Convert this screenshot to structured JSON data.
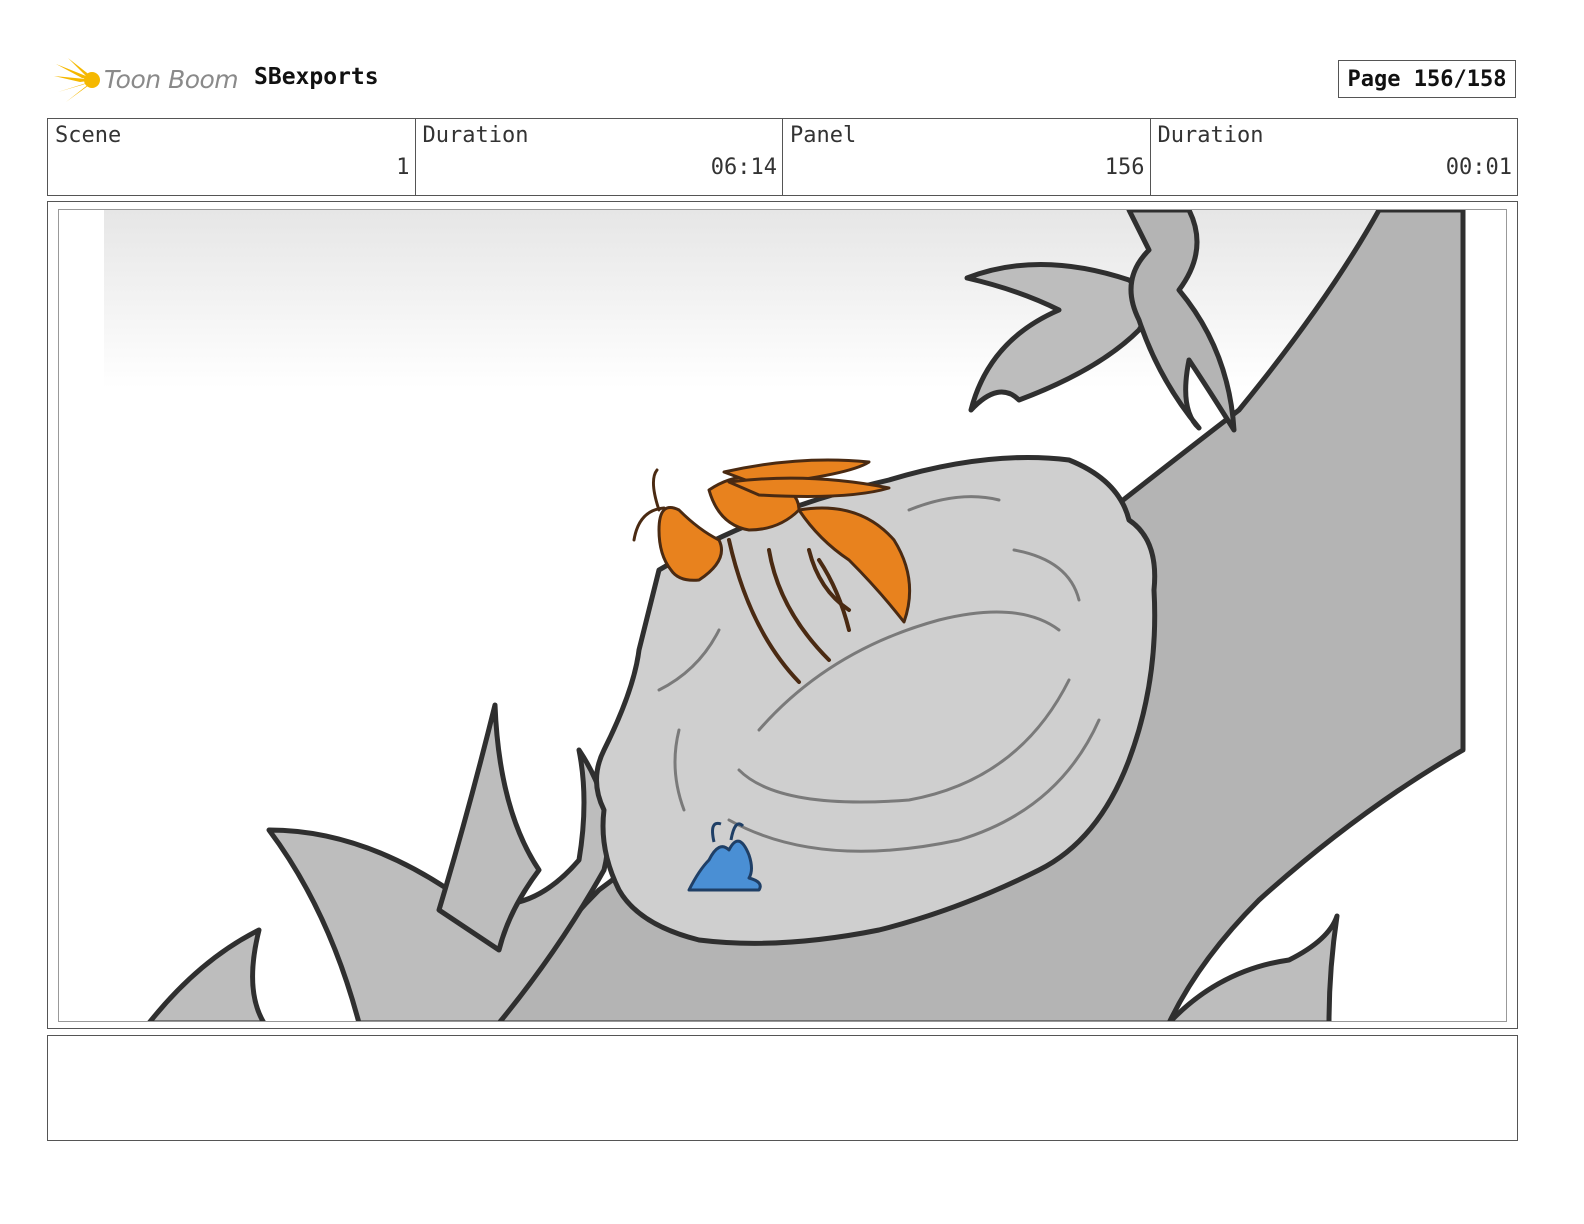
{
  "header": {
    "logo_text": "Toon Boom",
    "project_name": "SBexports",
    "page_label": "Page",
    "page_value": "156/158"
  },
  "info": {
    "scene_label": "Scene",
    "scene_value": "1",
    "scene_duration_label": "Duration",
    "scene_duration_value": "06:14",
    "panel_label": "Panel",
    "panel_value": "156",
    "panel_duration_label": "Duration",
    "panel_duration_value": "00:01"
  },
  "notes": {
    "text": ""
  },
  "colors": {
    "logo_star": "#f5b800",
    "logo_text": "#8a8a8a",
    "wasp": "#e8821e",
    "bug": "#4a8fd4",
    "branch": "#b4b4b4",
    "nest": "#cfcfcf",
    "leaf": "#bdbdbd",
    "outline": "#2f2f2f"
  }
}
